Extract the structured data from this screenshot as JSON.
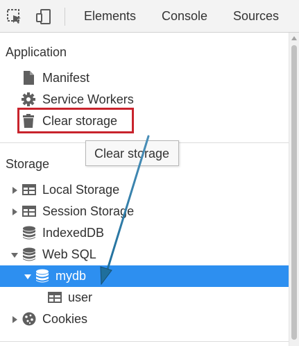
{
  "toolbar": {
    "icons": [
      "inspect-element-icon",
      "device-toolbar-icon"
    ],
    "tabs": [
      {
        "label": "Elements"
      },
      {
        "label": "Console"
      },
      {
        "label": "Sources"
      }
    ]
  },
  "sidebar": {
    "application": {
      "header": "Application",
      "items": [
        {
          "label": "Manifest",
          "icon": "document-icon"
        },
        {
          "label": "Service Workers",
          "icon": "gear-icon"
        },
        {
          "label": "Clear storage",
          "icon": "trash-icon"
        }
      ]
    },
    "storage": {
      "header": "Storage",
      "items": [
        {
          "label": "Local Storage",
          "icon": "table-grid-icon",
          "expanded": false
        },
        {
          "label": "Session Storage",
          "icon": "table-grid-icon",
          "expanded": false
        },
        {
          "label": "IndexedDB",
          "icon": "database-icon"
        },
        {
          "label": "Web SQL",
          "icon": "database-icon",
          "expanded": true
        },
        {
          "label": "mydb",
          "icon": "database-icon",
          "expanded": true,
          "selected": true
        },
        {
          "label": "user",
          "icon": "table-grid-icon"
        },
        {
          "label": "Cookies",
          "icon": "cookie-icon",
          "expanded": false
        }
      ]
    }
  },
  "tooltip": {
    "text": "Clear storage"
  },
  "colors": {
    "selection": "#2d8ff0",
    "highlight_border": "#c8232c",
    "annotation_arrow": "#1f6f9c",
    "toolbar_bg": "#f3f3f3"
  }
}
